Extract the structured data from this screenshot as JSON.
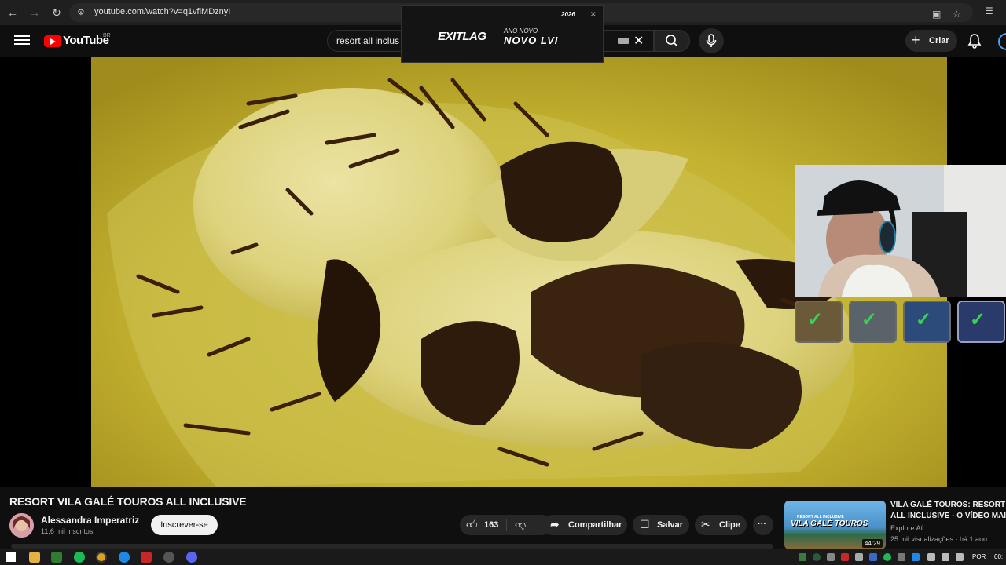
{
  "browser": {
    "url": "youtube.com/watch?v=q1vfiMDznyI",
    "back_icon": "arrow-left-icon",
    "forward_icon": "arrow-right-icon",
    "reload_icon": "reload-icon"
  },
  "header": {
    "logo_text": "YouTube",
    "country_code": "BR",
    "search_value": "resort all inclus",
    "create_label": "Criar"
  },
  "ad_overlay": {
    "brand": "EXITLAG",
    "subtitle": "ANO NOVO",
    "headline": "NOVO LVI",
    "year": "2026"
  },
  "video": {
    "title": "RESORT VILA GALÉ TOUROS ALL INCLUSIVE",
    "channel_name": "Alessandra Imperatriz",
    "subscribers": "11,6 mil inscritos",
    "subscribe_label": "Inscrever-se",
    "likes": "163",
    "share_label": "Compartilhar",
    "save_label": "Salvar",
    "clip_label": "Clipe",
    "more_label": "···"
  },
  "recommendation": {
    "title": "VILA GALÉ TOUROS: RESORT ALL INCLUSIVE - O VÍDEO MAI",
    "channel": "Explore Aí",
    "meta": "25 mil visualizações · há 1 ano",
    "duration": "44:29",
    "thumb_line1": "RESORT ALL INCLUSIVE",
    "thumb_line2": "VILA GALÉ TOUROS"
  },
  "taskbar": {
    "language": "POR",
    "time": "00:"
  },
  "colors": {
    "accent": "#ff0000",
    "background": "#0f0f0f",
    "check": "#39d353"
  }
}
